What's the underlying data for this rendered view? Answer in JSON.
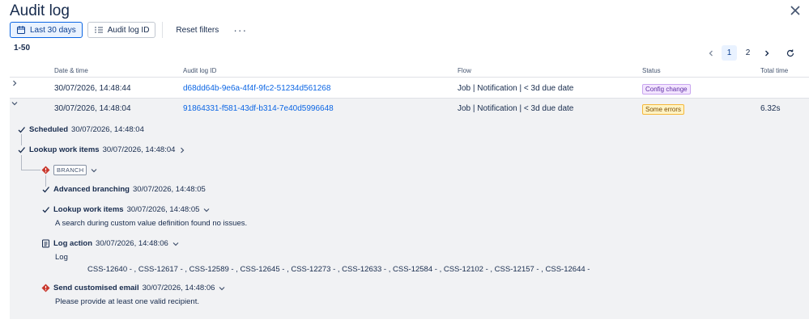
{
  "header": {
    "title": "Audit log"
  },
  "toolbar": {
    "date_filter": "Last 30 days",
    "id_filter": "Audit log ID",
    "reset": "Reset filters",
    "more": "···"
  },
  "range_label": "1-50",
  "pagination": {
    "pages": [
      "1",
      "2"
    ],
    "current": "1"
  },
  "table": {
    "columns": [
      "Date & time",
      "Audit log ID",
      "Flow",
      "Status",
      "Total time"
    ],
    "rows": [
      {
        "date": "30/07/2026, 14:48:44",
        "id": "d68dd64b-9e6a-4f4f-9fc2-51234d561268",
        "flow": "Job | Notification | < 3d due date",
        "status": "Config change",
        "total": ""
      },
      {
        "date": "30/07/2026, 14:48:04",
        "id": "91864331-f581-43df-b314-7e40d5996648",
        "flow": "Job | Notification | < 3d due date",
        "status": "Some errors",
        "total": "6.32s"
      }
    ]
  },
  "detail": {
    "scheduled": {
      "label": "Scheduled",
      "time": "30/07/2026, 14:48:04"
    },
    "lookup1": {
      "label": "Lookup work items",
      "time": "30/07/2026, 14:48:04"
    },
    "branch": "BRANCH",
    "adv_branch": {
      "label": "Advanced branching",
      "time": "30/07/2026, 14:48:05"
    },
    "lookup2": {
      "label": "Lookup work items",
      "time": "30/07/2026, 14:48:05",
      "message": "A search during custom value definition found no issues."
    },
    "log_action": {
      "label": "Log action",
      "time": "30/07/2026, 14:48:06",
      "sub": "Log",
      "message": "CSS-12640 - , CSS-12617 - , CSS-12589 - , CSS-12645 - , CSS-12273 - , CSS-12633 - , CSS-12584 - , CSS-12102 - , CSS-12157 - , CSS-12644 -"
    },
    "send_email": {
      "label": "Send customised email",
      "time": "30/07/2026, 14:48:06",
      "message": "Please provide at least one valid recipient."
    }
  }
}
